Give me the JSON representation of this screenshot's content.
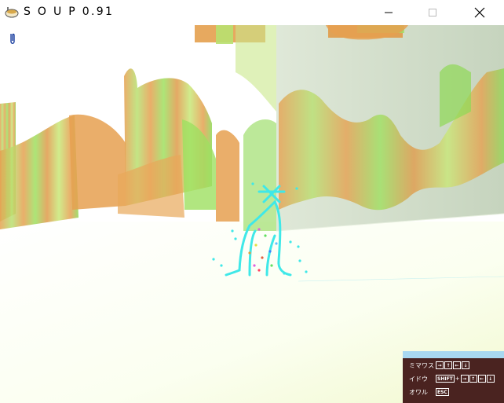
{
  "window": {
    "title": "S O U P 0.91"
  },
  "help": {
    "rows": [
      {
        "label": "ミマワス",
        "keys": [
          "→",
          "↑",
          "←",
          "↓"
        ],
        "prefix": ""
      },
      {
        "label": "イドウ",
        "keys": [
          "→",
          "↑",
          "←",
          "↓"
        ],
        "prefix": "SHIFT"
      },
      {
        "label": "オワル",
        "keys": [],
        "prefix": "ESC"
      }
    ]
  },
  "colors": {
    "figure": "#3fe8e8",
    "help_bg": "#4a2320",
    "help_top": "#a8d8f0",
    "wall_orange": "#e0a050",
    "wall_green": "#8fe060"
  },
  "icons": [
    "app-icon",
    "minimize-icon",
    "maximize-icon",
    "close-icon",
    "paperclip-icon"
  ]
}
